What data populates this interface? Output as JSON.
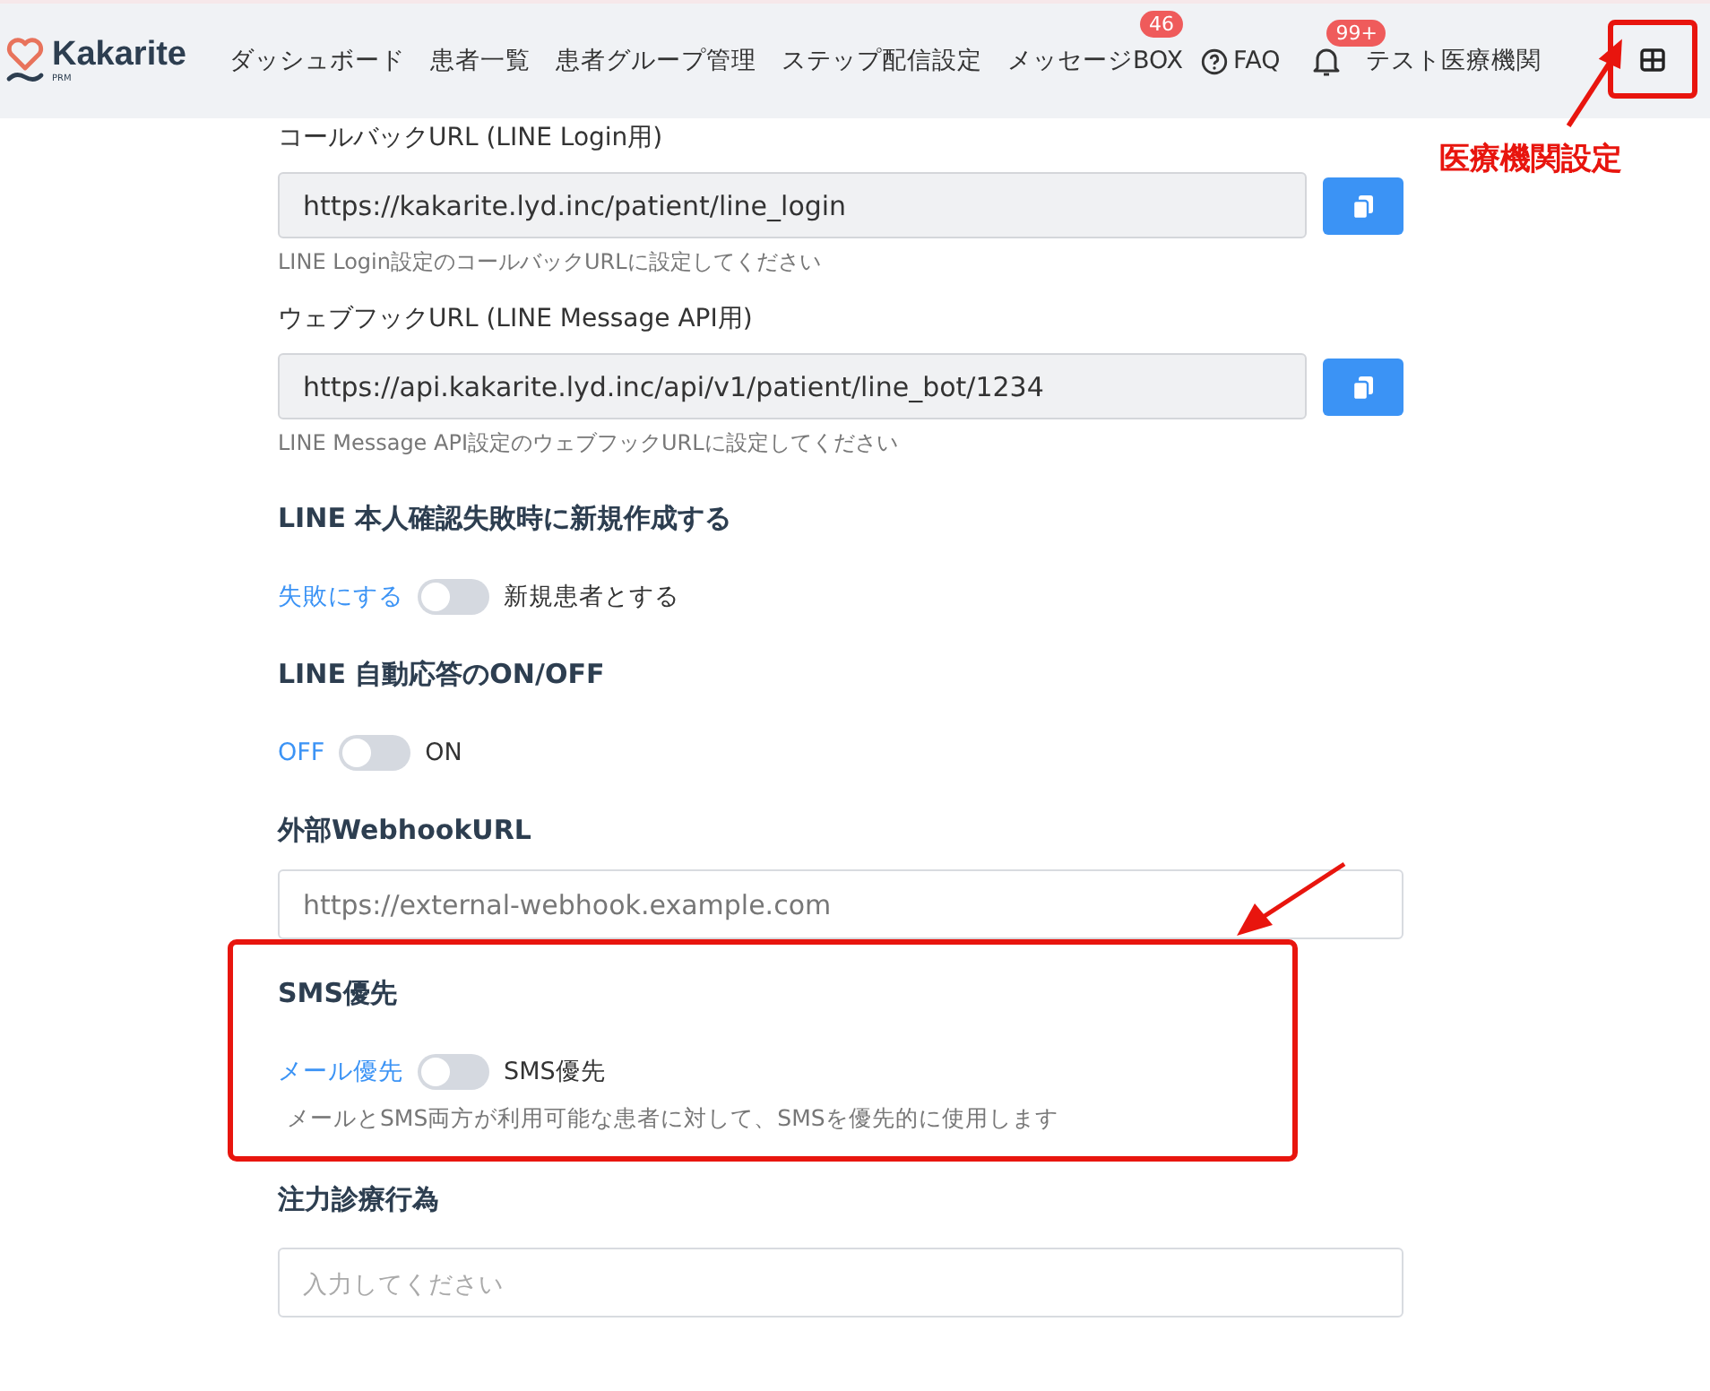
{
  "header": {
    "logo": "Kakarite",
    "logo_sub": "PRM",
    "nav": [
      {
        "label": "ダッシュボード"
      },
      {
        "label": "患者一覧"
      },
      {
        "label": "患者グループ管理"
      },
      {
        "label": "ステップ配信設定"
      },
      {
        "label": "メッセージBOX",
        "badge": "46"
      }
    ],
    "faq": "FAQ",
    "notification_badge": "99+",
    "org_name": "テスト医療機関"
  },
  "sections": [
    {
      "kind": "copy",
      "label": "コールバックURL (LINE Login用)",
      "value": "https://kakarite.lyd.inc/patient/line_login",
      "hint": "LINE Login設定のコールバックURLに設定してください"
    },
    {
      "kind": "copy",
      "label": "ウェブフックURL (LINE Message API用)",
      "value": "https://api.kakarite.lyd.inc/api/v1/patient/line_bot/1234",
      "hint": "LINE Message API設定のウェブフックURLに設定してください"
    },
    {
      "kind": "toggle",
      "title": "LINE 本人確認失敗時に新規作成する",
      "off_label": "失敗にする",
      "on_label": "新規患者とする",
      "on": false
    },
    {
      "kind": "toggle",
      "title": "LINE 自動応答のON/OFF",
      "off_label": "OFF",
      "on_label": "ON",
      "on": false
    },
    {
      "kind": "input",
      "title": "外部WebhookURL",
      "placeholder": "https://external-webhook.example.com"
    },
    {
      "kind": "toggle",
      "title": "SMS優先",
      "off_label": "メール優先",
      "on_label": "SMS優先",
      "on": false,
      "hint": "メールとSMS両方が利用可能な患者に対して、SMSを優先的に使用します",
      "highlighted": true
    },
    {
      "kind": "input",
      "title": "注力診療行為",
      "placeholder": "入力してください"
    }
  ],
  "annotation": {
    "label": "医療機関設定"
  }
}
